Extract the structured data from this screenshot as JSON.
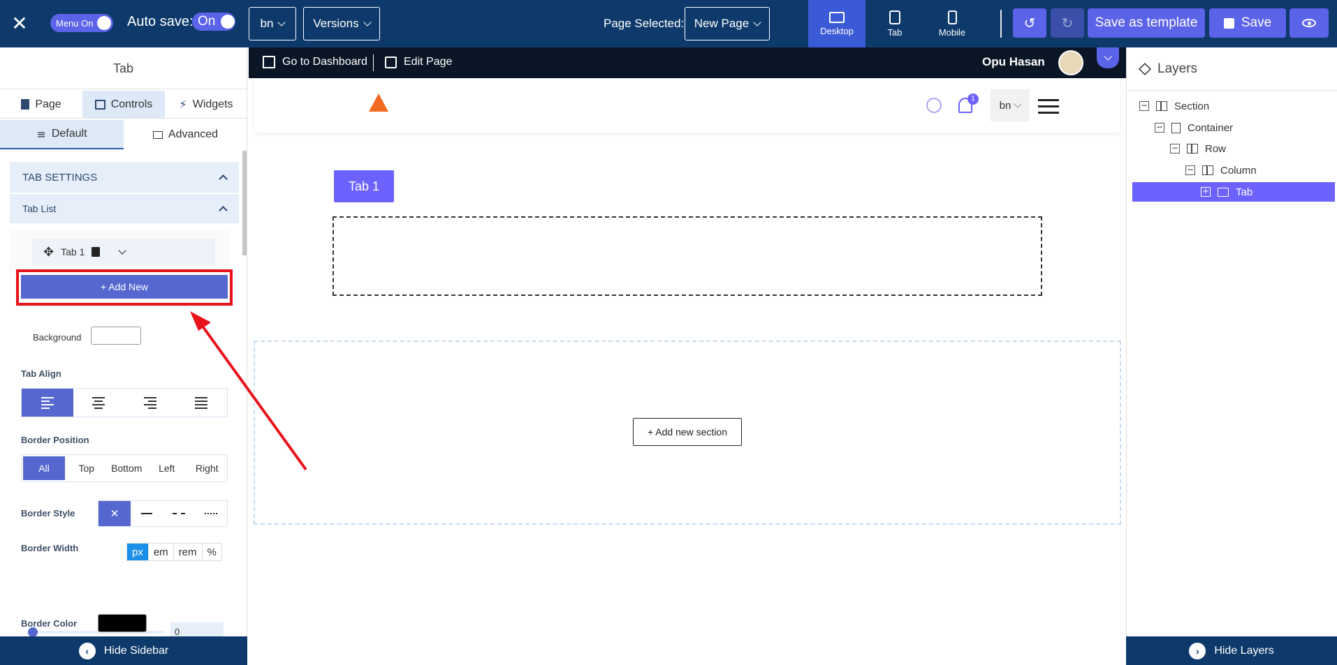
{
  "topbar": {
    "close_icon": "close-icon",
    "menu_toggle_label": "Menu On",
    "autosave_label": "Auto save:",
    "autosave_value": "On",
    "lang_value": "bn",
    "versions_label": "Versions",
    "page_selected_label": "Page Selected:",
    "page_selected_value": "New Page",
    "devices": [
      {
        "label": "Desktop",
        "active": true
      },
      {
        "label": "Tab",
        "active": false
      },
      {
        "label": "Mobile",
        "active": false
      }
    ],
    "save_template_label": "Save as template",
    "save_label": "Save",
    "accent_color": "#5b63e8",
    "bar_color": "#0e3a6b"
  },
  "sidebar": {
    "title": "Tab",
    "tabs": [
      "Page",
      "Controls",
      "Widgets"
    ],
    "active_tab": "Controls",
    "subtabs": [
      "Default",
      "Advanced"
    ],
    "active_subtab": "Default",
    "section_title": "TAB SETTINGS",
    "tab_list_title": "Tab List",
    "tab_items": [
      "Tab 1"
    ],
    "add_new_label": "+ Add New",
    "background_label": "Background",
    "tab_align_label": "Tab Align",
    "border_position_label": "Border Position",
    "border_positions": [
      "All",
      "Top",
      "Bottom",
      "Left",
      "Right"
    ],
    "border_style_label": "Border Style",
    "border_width_label": "Border Width",
    "units": [
      "px",
      "em",
      "rem",
      "%"
    ],
    "active_unit": "px",
    "border_width_value": "0",
    "border_color_label": "Border Color",
    "border_color_value": "#000000",
    "hide_label": "Hide Sidebar"
  },
  "canvas": {
    "dashboard_label": "Go to Dashboard",
    "edit_page_label": "Edit Page",
    "user_name": "Opu Hasan",
    "notification_count": "1",
    "site_lang": "bn",
    "tab_label": "Tab 1",
    "add_section_label": "+ Add new section",
    "tab_color": "#6c63ff"
  },
  "layers": {
    "title": "Layers",
    "items": [
      "Section",
      "Container",
      "Row",
      "Column",
      "Tab"
    ],
    "selected": "Tab",
    "hide_label": "Hide Layers"
  },
  "annotation": {
    "highlight_color": "#e8121b"
  }
}
